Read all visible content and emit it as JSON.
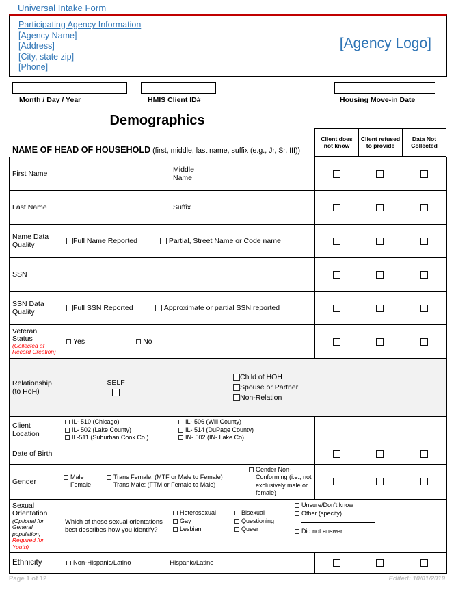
{
  "header": {
    "form_title": "Universal Intake Form",
    "agency_heading": "Participating Agency Information",
    "agency_name": "[Agency Name]",
    "agency_address": "[Address]",
    "agency_city": "[City, state zip]",
    "agency_phone": "[Phone]",
    "agency_logo": "[Agency Logo]",
    "accent_red": "#C00000",
    "link_blue": "#2E74B5"
  },
  "fields": {
    "date_label": "Month   /   Day   /   Year",
    "date_value": "",
    "client_id_label": "HMIS Client ID#",
    "client_id_value": "",
    "movein_label": "Housing Move-in Date",
    "movein_value": ""
  },
  "section": {
    "title": "Demographics",
    "hoh_label_smallcaps": "NAME OF HEAD OF HOUSEHOLD",
    "hoh_label_rest": " (first, middle, last name, suffix (e.g., Jr, Sr, III))"
  },
  "columns": [
    "Client does not know",
    "Client refused to provide",
    "Data Not Collected"
  ],
  "rows": {
    "first_name": {
      "label": "First Name",
      "value": "",
      "mid_label": "Middle Name",
      "mid_value": ""
    },
    "last_name": {
      "label": "Last Name",
      "value": "",
      "mid_label": "Suffix",
      "mid_value": ""
    },
    "name_data_quality": {
      "label": "Name Data Quality",
      "opt1": "Full Name Reported",
      "opt2": "Partial, Street Name or Code name"
    },
    "ssn": {
      "label": "SSN",
      "value": ""
    },
    "ssn_data_quality": {
      "label": "SSN Data Quality",
      "opt1": "Full SSN Reported",
      "opt2": "Approximate or partial SSN reported"
    },
    "veteran_status": {
      "label": "Veteran Status",
      "note": "(Collected at Record Creation)",
      "opt_yes": "Yes",
      "opt_no": "No"
    },
    "relationship": {
      "label": "Relationship (to HoH)",
      "self_label": "SELF",
      "opt1": "Child of HOH",
      "opt2": "Spouse or Partner",
      "opt3": "Non-Relation"
    },
    "client_location": {
      "label": "Client Location",
      "left": [
        "IL- 510 (Chicago)",
        "IL- 502 (Lake County)",
        "IL-511 (Suburban Cook Co.)"
      ],
      "right": [
        "IL- 506 (Will County)",
        "IL- 514 (DuPage County)",
        "IN- 502 (IN- Lake Co)"
      ]
    },
    "date_of_birth": {
      "label": "Date of Birth",
      "value": ""
    },
    "gender": {
      "label": "Gender",
      "col1": [
        "Male",
        "Female"
      ],
      "col2": [
        "Trans Female: (MTF or Male to Female)",
        "Trans Male: (FTM or Female to Male)"
      ],
      "col3": "Gender Non-Conforming (i.e., not exclusively male or female)"
    },
    "sexual_orientation": {
      "label": "Sexual Orientation",
      "note_black": "(Optional for General population,",
      "note_red": "Required for Youth)",
      "question": "Which of these sexual orientations best describes how you identify?",
      "col1": [
        "Heterosexual",
        "Gay",
        "Lesbian"
      ],
      "col2": [
        "Bisexual",
        "Questioning",
        "Queer"
      ],
      "col3": [
        "Unsure/Don't know",
        "Other (specify)"
      ],
      "col3_last": "Did not answer",
      "specify_value": ""
    },
    "ethnicity": {
      "label": "Ethnicity",
      "opt1": "Non-Hispanic/Latino",
      "opt2": "Hispanic/Latino"
    }
  },
  "footer": {
    "page": "Page 1 of 12",
    "edited": "Edited: 10/01/2019"
  }
}
